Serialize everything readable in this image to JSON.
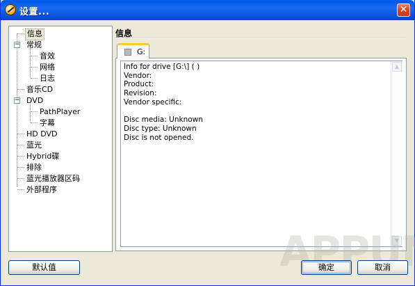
{
  "window": {
    "title": "设置...",
    "close_glyph": "✕"
  },
  "tree": {
    "items": [
      {
        "label": "信息",
        "selected": true
      },
      {
        "label": "常规",
        "expander": "−"
      },
      {
        "label": "音效"
      },
      {
        "label": "网络"
      },
      {
        "label": "日志"
      },
      {
        "label": "音乐CD"
      },
      {
        "label": "DVD",
        "expander": "−"
      },
      {
        "label": "PathPlayer"
      },
      {
        "label": "字幕"
      },
      {
        "label": "HD DVD"
      },
      {
        "label": "蓝光"
      },
      {
        "label": "Hybrid碟"
      },
      {
        "label": "排除"
      },
      {
        "label": "蓝光播放器区码"
      },
      {
        "label": "外部程序"
      }
    ]
  },
  "panel": {
    "title": "信息",
    "tab_label": "G:",
    "info_lines": [
      "Info for drive [G:\\] ( )",
      "Vendor:",
      "Product:",
      "Revision:",
      "Vendor specific:",
      "",
      "Disc media: Unknown",
      "Disc type: Unknown",
      "Disc is not opened."
    ]
  },
  "scrollbar": {
    "up_glyph": "▲",
    "down_glyph": "▼"
  },
  "watermark": "APPUN",
  "buttons": {
    "defaults": "默认值",
    "ok": "确定",
    "cancel": "取消"
  },
  "colors": {
    "titlebar": "#0058e6",
    "face": "#ece9d8",
    "border": "#7f9db9"
  }
}
